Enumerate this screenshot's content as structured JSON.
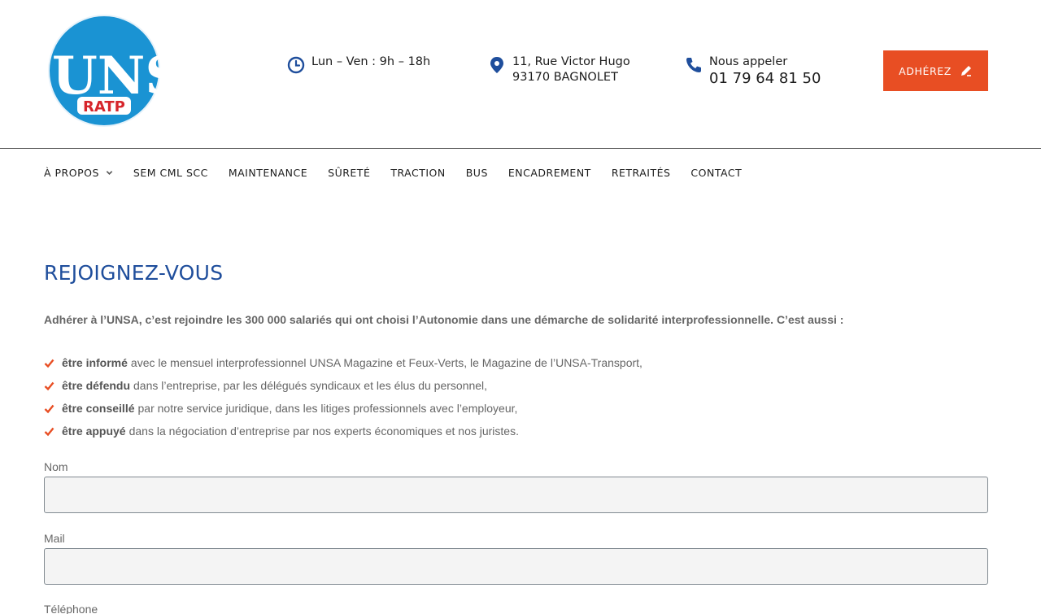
{
  "header": {
    "logo": {
      "main_text": "UNSa",
      "sub_text": "RATP"
    },
    "hours": {
      "icon": "clock-icon",
      "text": "Lun – Ven : 9h – 18h"
    },
    "address": {
      "icon": "map-pin-icon",
      "line1": "11, Rue Victor Hugo",
      "line2": "93170 BAGNOLET"
    },
    "phone": {
      "icon": "phone-icon",
      "label": "Nous appeler",
      "number": "01 79 64 81 50"
    },
    "join_button": {
      "label": "ADHÉREZ",
      "icon": "pencil-icon"
    }
  },
  "nav": {
    "items": [
      {
        "label": "À PROPOS",
        "has_dropdown": true
      },
      {
        "label": "SEM CML SCC"
      },
      {
        "label": "MAINTENANCE"
      },
      {
        "label": "SÛRETÉ"
      },
      {
        "label": "TRACTION"
      },
      {
        "label": "BUS"
      },
      {
        "label": "ENCADREMENT"
      },
      {
        "label": "RETRAITÉS"
      },
      {
        "label": "CONTACT"
      }
    ]
  },
  "main": {
    "title": "REJOIGNEZ-VOUS",
    "intro": "Adhérer à l’UNSA, c’est rejoindre les 300 000 salariés qui ont choisi l’Autonomie dans une démarche de solidarité interprofessionnelle. C’est aussi :",
    "benefits": [
      {
        "bold": "être informé",
        "rest": "avec le mensuel interprofessionnel UNSA Magazine et Feux-Verts, le Magazine de l’UNSA-Transport,"
      },
      {
        "bold": "être défendu",
        "rest": "dans l’entreprise,  par les délégués syndicaux  et les élus du personnel,"
      },
      {
        "bold": "être conseillé",
        "rest": "par notre service juridique, dans les litiges professionnels avec l’employeur,"
      },
      {
        "bold": "être appuyé",
        "rest": "dans la négociation d’entreprise par nos experts économiques et nos juristes."
      }
    ],
    "form": {
      "name_label": "Nom",
      "name_value": "",
      "mail_label": "Mail",
      "mail_value": "",
      "phone_label": "Téléphone"
    }
  },
  "colors": {
    "brand_blue": "#1f4e9c",
    "accent_orange": "#e84e23",
    "check_red": "#e84e23",
    "logo_blue": "#1a93d3",
    "logo_red": "#d6252b"
  }
}
